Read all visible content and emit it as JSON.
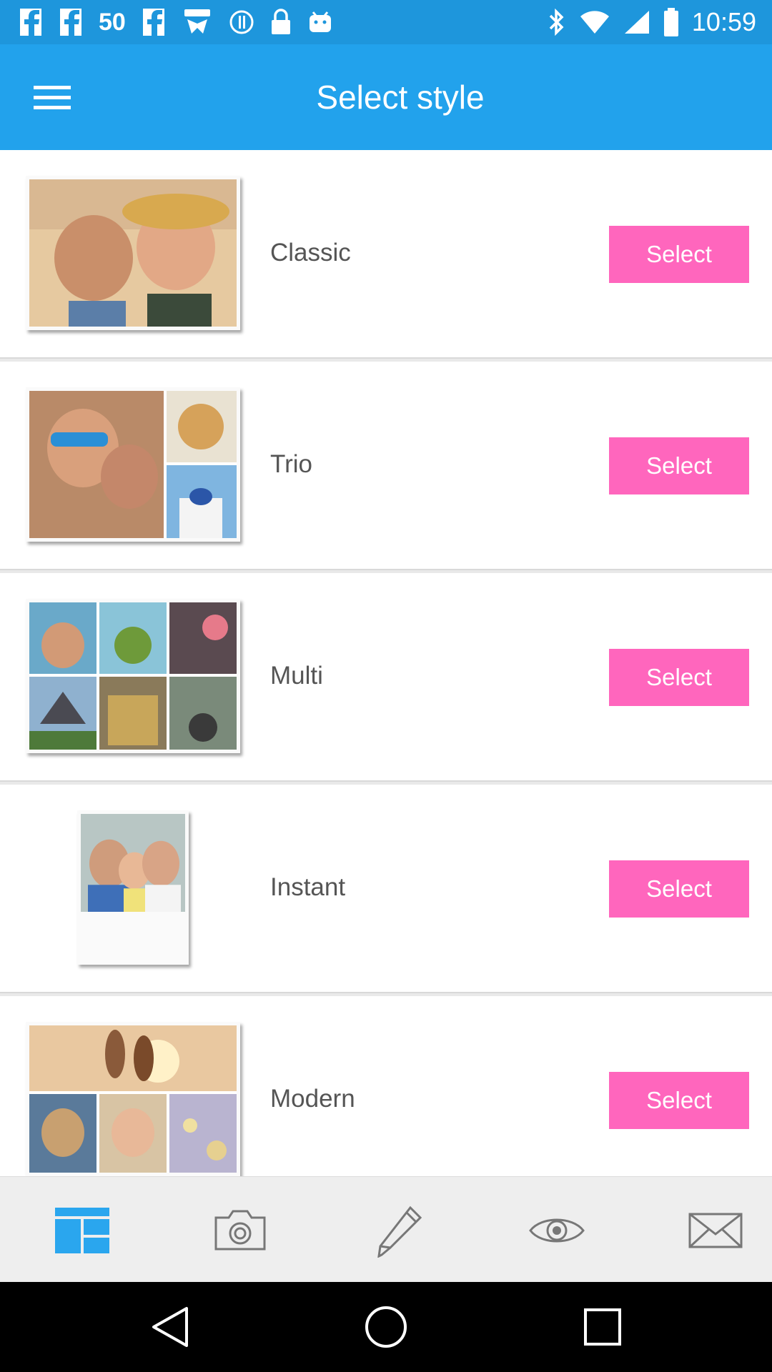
{
  "status_bar": {
    "left_text": "50",
    "time": "10:59",
    "icons": [
      "fb-icon",
      "fb-icon",
      "fb-icon",
      "fake-gps-icon",
      "sync-icon",
      "lock-icon",
      "android-icon",
      "bluetooth-icon",
      "wifi-icon",
      "signal-icon",
      "battery-icon"
    ]
  },
  "app_bar": {
    "title": "Select style",
    "menu_icon": "hamburger-menu-icon"
  },
  "styles": [
    {
      "name": "Classic",
      "button": "Select"
    },
    {
      "name": "Trio",
      "button": "Select"
    },
    {
      "name": "Multi",
      "button": "Select"
    },
    {
      "name": "Instant",
      "button": "Select"
    },
    {
      "name": "Modern",
      "button": "Select"
    }
  ],
  "toolbar": {
    "items": [
      "layout-icon",
      "camera-icon",
      "pencil-icon",
      "eye-icon",
      "mail-icon"
    ],
    "active_color": "#2aa6ee",
    "icon_color": "#777777"
  },
  "nav_bar": {
    "items": [
      "back-icon",
      "home-icon",
      "recents-icon"
    ]
  },
  "colors": {
    "status_bar": "#1e96dc",
    "app_bar": "#22a2ec",
    "select_button": "#ff66bd"
  }
}
